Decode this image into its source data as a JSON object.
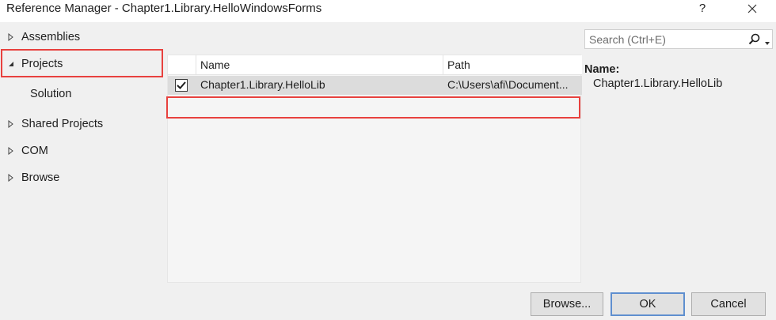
{
  "window": {
    "title": "Reference Manager - Chapter1.Library.HelloWindowsForms",
    "help_label": "?"
  },
  "nav": {
    "items": [
      {
        "label": "Assemblies",
        "expanded": false
      },
      {
        "label": "Projects",
        "expanded": true,
        "selected": true
      },
      {
        "label": "Solution",
        "child": true
      },
      {
        "label": "Shared Projects",
        "expanded": false
      },
      {
        "label": "COM",
        "expanded": false
      },
      {
        "label": "Browse",
        "expanded": false
      }
    ]
  },
  "grid": {
    "columns": [
      "Name",
      "Path"
    ],
    "rows": [
      {
        "checked": true,
        "name": "Chapter1.Library.HelloLib",
        "path": "C:\\Users\\afi\\Document..."
      }
    ]
  },
  "search": {
    "placeholder": "Search (Ctrl+E)",
    "value": ""
  },
  "details": {
    "label": "Name:",
    "value": "Chapter1.Library.HelloLib"
  },
  "buttons": {
    "browse": "Browse...",
    "ok": "OK",
    "cancel": "Cancel"
  },
  "colors": {
    "highlight": "#e8413e",
    "panel_bg": "#f0f0f0",
    "selected_row": "#dcdcdc",
    "default_button_border": "#5f8fcf"
  },
  "icons": {
    "collapsed_arrow": "triangle-right-outline",
    "expanded_arrow": "triangle-down-left-filled",
    "search": "magnifier",
    "search_options": "dropdown-caret",
    "close": "x"
  }
}
